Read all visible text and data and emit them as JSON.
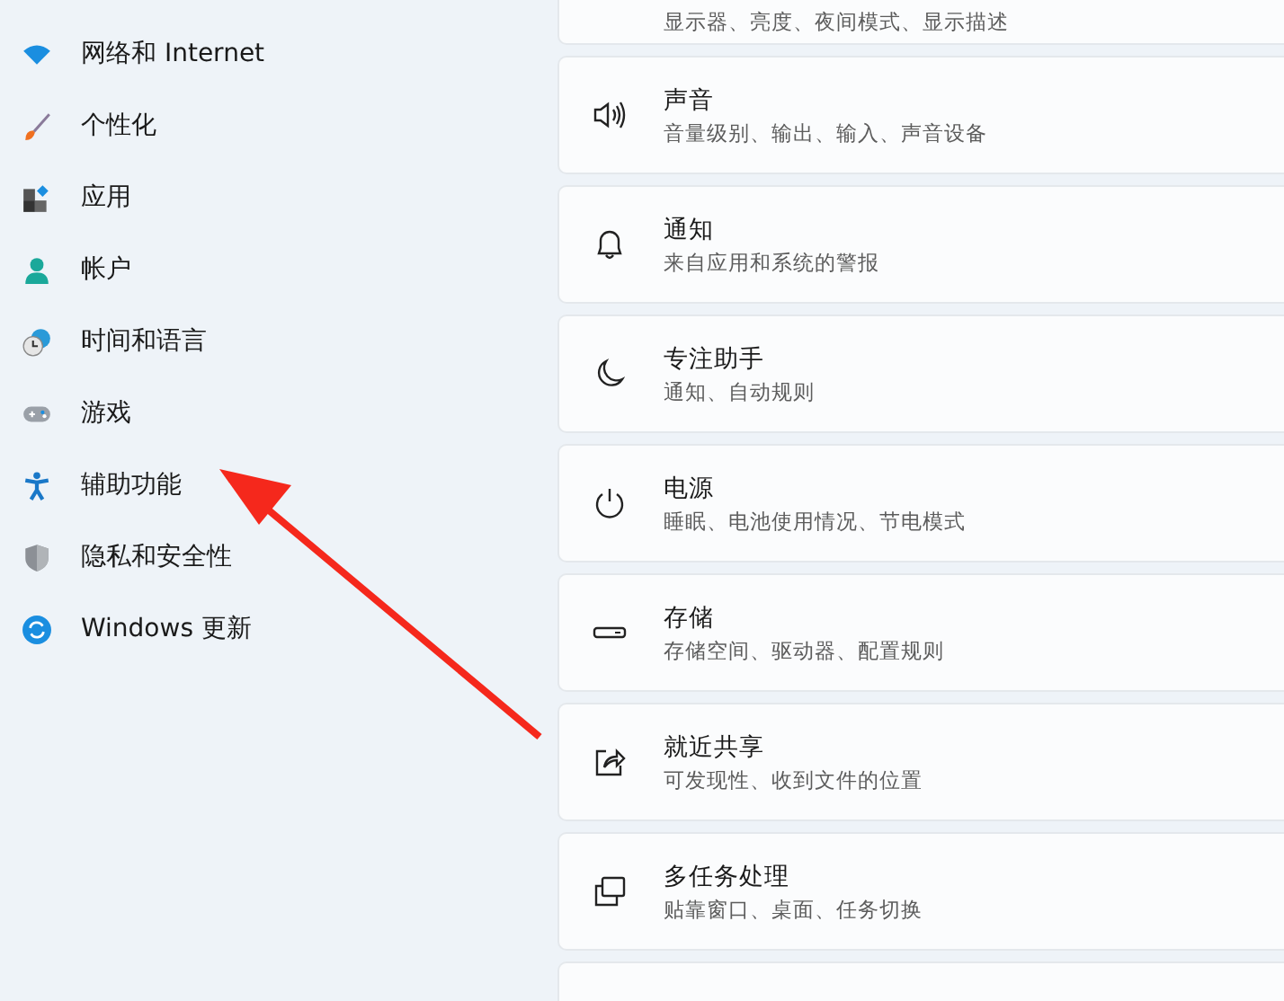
{
  "sidebar": {
    "items": [
      {
        "label": "网络和 Internet"
      },
      {
        "label": "个性化"
      },
      {
        "label": "应用"
      },
      {
        "label": "帐户"
      },
      {
        "label": "时间和语言"
      },
      {
        "label": "游戏"
      },
      {
        "label": "辅助功能"
      },
      {
        "label": "隐私和安全性"
      },
      {
        "label": "Windows 更新"
      }
    ]
  },
  "settings": [
    {
      "subtitle": "显示器、亮度、夜间模式、显示描述"
    },
    {
      "title": "声音",
      "subtitle": "音量级别、输出、输入、声音设备"
    },
    {
      "title": "通知",
      "subtitle": "来自应用和系统的警报"
    },
    {
      "title": "专注助手",
      "subtitle": "通知、自动规则"
    },
    {
      "title": "电源",
      "subtitle": "睡眠、电池使用情况、节电模式"
    },
    {
      "title": "存储",
      "subtitle": "存储空间、驱动器、配置规则"
    },
    {
      "title": "就近共享",
      "subtitle": "可发现性、收到文件的位置"
    },
    {
      "title": "多任务处理",
      "subtitle": "贴靠窗口、桌面、任务切换"
    }
  ],
  "annotation_arrow": {
    "color": "#f5281c"
  }
}
